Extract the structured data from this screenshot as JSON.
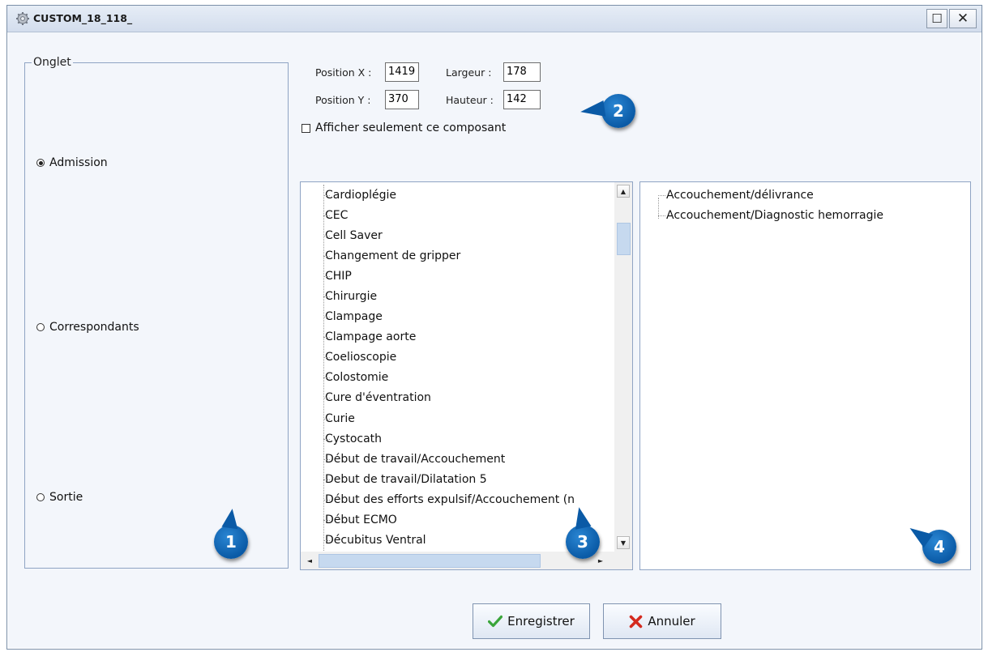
{
  "window": {
    "title": "CUSTOM_18_118_"
  },
  "onglet": {
    "legend": "Onglet",
    "options": [
      {
        "label": "Admission",
        "selected": true
      },
      {
        "label": "Correspondants",
        "selected": false
      },
      {
        "label": "Sortie",
        "selected": false
      }
    ]
  },
  "geometry": {
    "position_x_label": "Position X :",
    "position_x": "1419",
    "position_y_label": "Position Y :",
    "position_y": "370",
    "largeur_label": "Largeur :",
    "largeur": "178",
    "hauteur_label": "Hauteur :",
    "hauteur": "142"
  },
  "show_only_label": "Afficher seulement ce composant",
  "left_list": [
    "Cardioplégie",
    "CEC",
    "Cell Saver",
    "Changement de gripper",
    "CHIP",
    "Chirurgie",
    "Clampage",
    "Clampage aorte",
    "Coelioscopie",
    "Colostomie",
    "Cure d'éventration",
    "Curie",
    "Cystocath",
    "Début de travail/Accouchement",
    "Debut de travail/Dilatation 5",
    "Début des efforts expulsif/Accouchement (n",
    "Début ECMO",
    "Décubitus Ventral"
  ],
  "right_list": [
    "Accouchement/délivrance",
    "Accouchement/Diagnostic hemorragie"
  ],
  "buttons": {
    "save": "Enregistrer",
    "cancel": "Annuler"
  },
  "callouts": [
    "1",
    "2",
    "3",
    "4"
  ],
  "colors": {
    "callout": "#0a5aa6",
    "save_check": "#3aa53a",
    "cancel_x": "#d42a1e",
    "panel_border": "#8fa4c4"
  }
}
